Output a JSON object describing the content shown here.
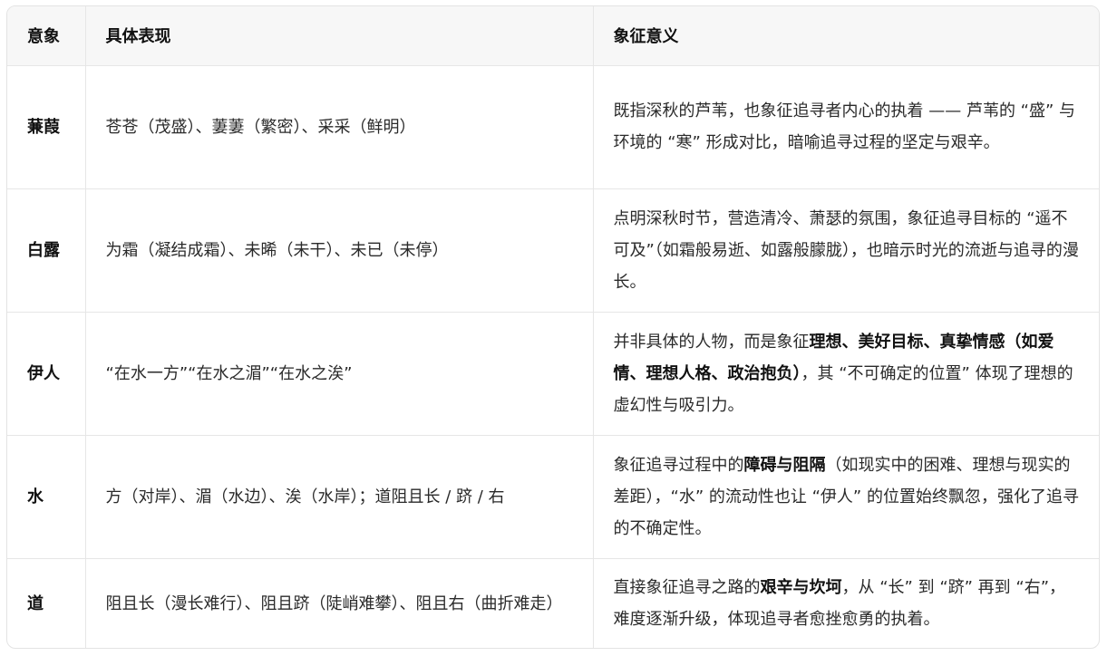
{
  "table": {
    "headers": [
      "意象",
      "具体表现",
      "象征意义"
    ],
    "rows": [
      {
        "term": "蒹葭",
        "detail": "苍苍（茂盛）、萋萋（繁密）、采采（鲜明）",
        "meaning": [
          {
            "text": "既指深秋的芦苇，也象征追寻者内心的执着 —— 芦苇的 “盛” 与环境的 “寒” 形成对比，暗喻追寻过程的坚定与艰辛。",
            "bold": false
          }
        ]
      },
      {
        "term": "白露",
        "detail": "为霜（凝结成霜）、未晞（未干）、未已（未停）",
        "meaning": [
          {
            "text": "点明深秋时节，营造清冷、萧瑟的氛围，象征追寻目标的 “遥不可及”（如霜般易逝、如露般朦胧），也暗示时光的流逝与追寻的漫长。",
            "bold": false
          }
        ]
      },
      {
        "term": "伊人",
        "detail": "“在水一方”“在水之湄”“在水之涘”",
        "meaning": [
          {
            "text": "并非具体的人物，而是象征",
            "bold": false
          },
          {
            "text": "理想、美好目标、真挚情感（如爱情、理想人格、政治抱负）",
            "bold": true
          },
          {
            "text": "，其 “不可确定的位置” 体现了理想的虚幻性与吸引力。",
            "bold": false
          }
        ]
      },
      {
        "term": "水",
        "detail": "方（对岸）、湄（水边）、涘（水岸）；道阻且长 / 跻 / 右",
        "meaning": [
          {
            "text": "象征追寻过程中的",
            "bold": false
          },
          {
            "text": "障碍与阻隔",
            "bold": true
          },
          {
            "text": "（如现实中的困难、理想与现实的差距），“水” 的流动性也让 “伊人” 的位置始终飘忽，强化了追寻的不确定性。",
            "bold": false
          }
        ]
      },
      {
        "term": "道",
        "detail": "阻且长（漫长难行）、阻且跻（陡峭难攀）、阻且右（曲折难走）",
        "meaning": [
          {
            "text": "直接象征追寻之路的",
            "bold": false
          },
          {
            "text": "艰辛与坎坷",
            "bold": true
          },
          {
            "text": "，从 “长” 到 “跻” 再到 “右”，难度逐渐升级，体现追寻者愈挫愈勇的执着。",
            "bold": false
          }
        ]
      }
    ]
  }
}
